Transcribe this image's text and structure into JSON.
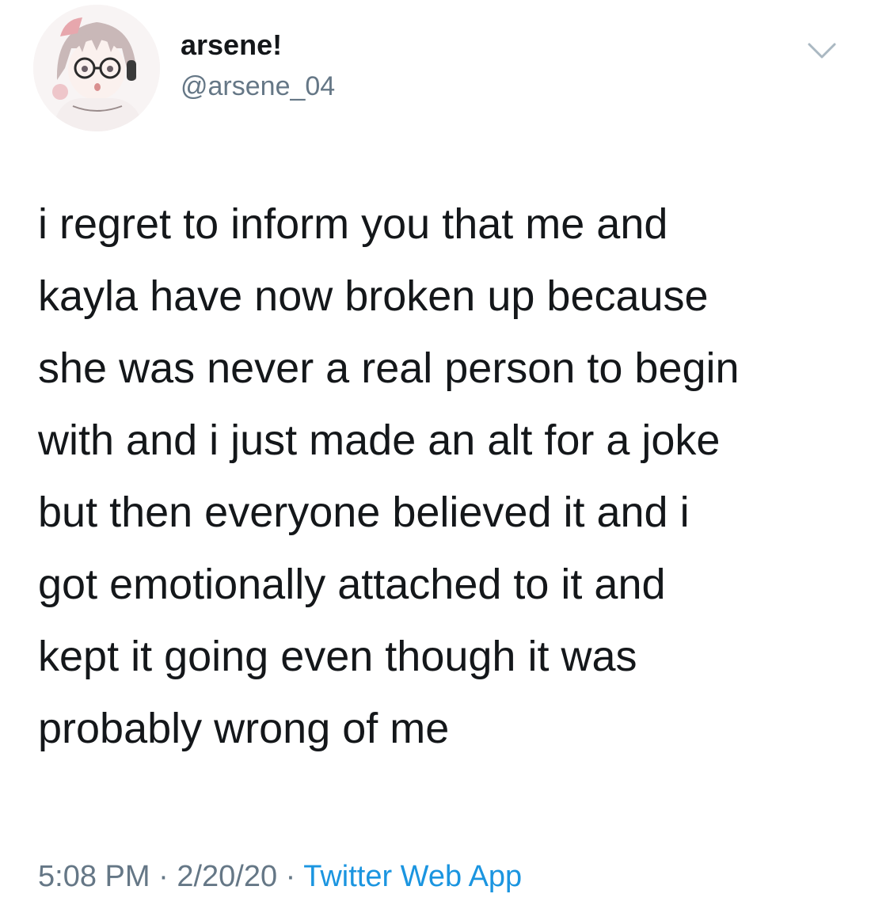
{
  "user": {
    "display_name": "arsene!",
    "handle": "@arsene_04",
    "avatar_icon": "anime-girl-avatar"
  },
  "header": {
    "menu_icon": "chevron-down-icon"
  },
  "tweet": {
    "text": "i regret to inform you that me and\nkayla have now broken up because\nshe was never a real person to begin\nwith and i just made an alt for a joke\nbut then everyone believed it and i\ngot emotionally attached to it and\nkept it going even though it was\nprobably wrong of me"
  },
  "meta": {
    "time": "5:08 PM",
    "separator": " · ",
    "date": "2/20/20",
    "source": "Twitter Web App"
  },
  "colors": {
    "text": "#14171a",
    "secondary": "#657786",
    "link": "#1b95e0",
    "chevron": "#aab8c2"
  }
}
